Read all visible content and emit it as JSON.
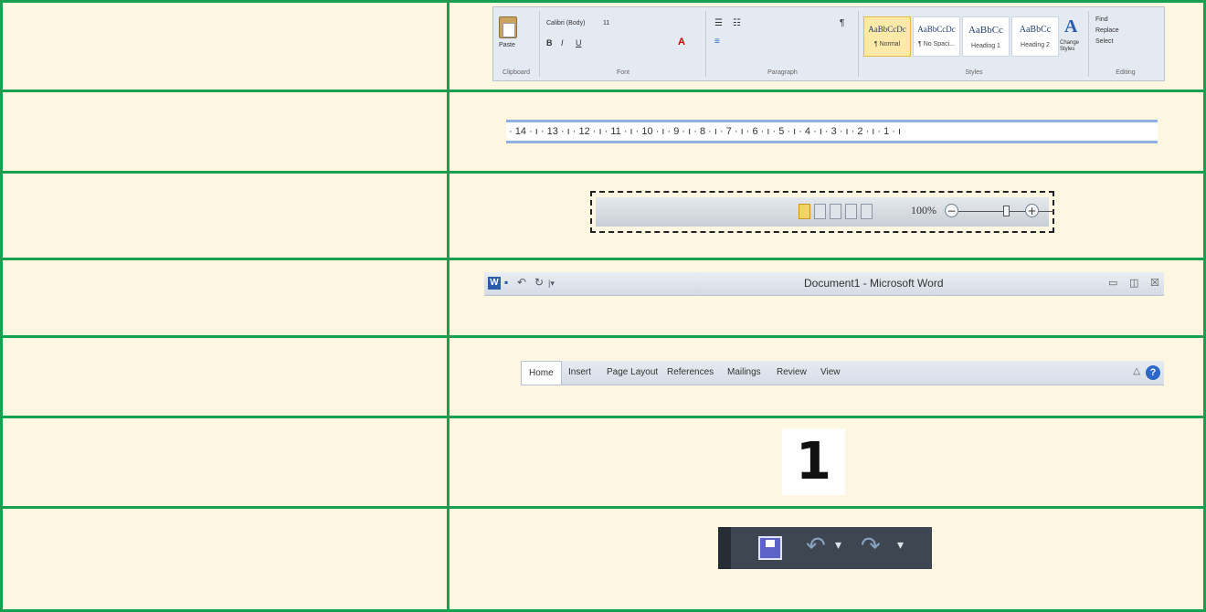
{
  "ribbon": {
    "paste_label": "Paste",
    "clipboard_label": "Clipboard",
    "font_name": "Calibri (Body)",
    "font_size": "11",
    "font_label": "Font",
    "paragraph_label": "Paragraph",
    "styles_label": "Styles",
    "editing_label": "Editing",
    "styles": [
      {
        "preview": "AaBbCcDc",
        "name": "¶ Normal"
      },
      {
        "preview": "AaBbCcDc",
        "name": "¶ No Spaci..."
      },
      {
        "preview": "AaBbCc",
        "name": "Heading 1"
      },
      {
        "preview": "AaBbCc",
        "name": "Heading 2"
      }
    ],
    "change_styles": "Change Styles",
    "find": "Find",
    "replace": "Replace",
    "select": "Select"
  },
  "ruler": {
    "ticks": [
      "14",
      "13",
      "12",
      "11",
      "10",
      "9",
      "8",
      "7",
      "6",
      "5",
      "4",
      "3",
      "2",
      "1"
    ]
  },
  "status": {
    "zoom": "100%",
    "minus": "−",
    "plus": "+"
  },
  "titlebar": {
    "logo": "W",
    "title": "Document1 - Microsoft Word",
    "min": "▭",
    "max": "◫",
    "close": "☒"
  },
  "tabs": {
    "items": [
      "Home",
      "Insert",
      "Page Layout",
      "References",
      "Mailings",
      "Review",
      "View"
    ],
    "help": "?"
  },
  "number": {
    "value": "1"
  }
}
